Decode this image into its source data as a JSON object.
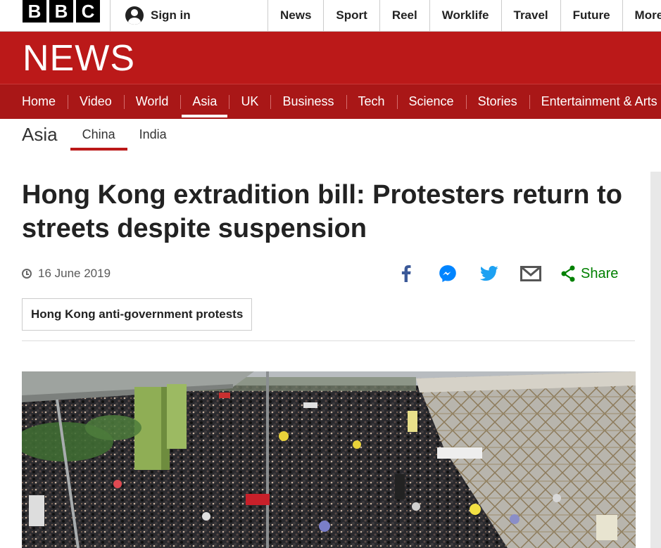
{
  "brand": {
    "letters": [
      "B",
      "B",
      "C"
    ],
    "news_label": "NEWS"
  },
  "account": {
    "sign_in_label": "Sign in"
  },
  "top_nav": [
    "News",
    "Sport",
    "Reel",
    "Worklife",
    "Travel",
    "Future",
    "More"
  ],
  "section_nav": {
    "items": [
      "Home",
      "Video",
      "World",
      "Asia",
      "UK",
      "Business",
      "Tech",
      "Science",
      "Stories",
      "Entertainment & Arts"
    ],
    "active": "Asia"
  },
  "sub_nav": {
    "section": "Asia",
    "items": [
      "China",
      "India"
    ],
    "active": "China"
  },
  "article": {
    "headline": "Hong Kong extradition bill: Protesters return to streets despite suspension",
    "date": "16 June 2019",
    "tag": "Hong Kong anti-government protests",
    "share_label": "Share"
  },
  "share_icons": [
    "facebook-icon",
    "messenger-icon",
    "twitter-icon",
    "email-icon",
    "share-icon"
  ],
  "colors": {
    "brand_red": "#bb1919",
    "nav_red": "#a91717",
    "share_green": "#008000",
    "facebook_blue": "#3b5998",
    "messenger_blue": "#0084ff",
    "twitter_blue": "#1da1f2"
  }
}
